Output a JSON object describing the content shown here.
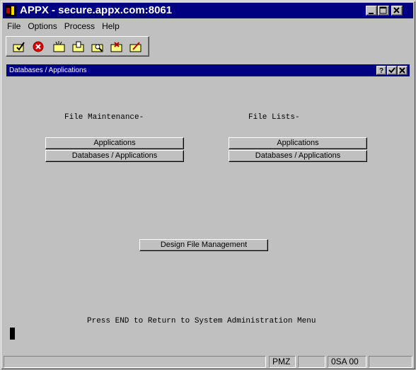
{
  "window": {
    "title": "APPX - secure.appx.com:8061"
  },
  "menu": {
    "items": [
      "File",
      "Options",
      "Process",
      "Help"
    ]
  },
  "toolbar": {
    "icons": [
      "check-folder-icon",
      "cancel-icon",
      "new-folder-icon",
      "open-folder-icon",
      "search-folder-icon",
      "delete-folder-icon",
      "edit-folder-icon"
    ]
  },
  "form": {
    "title": "Databases / Applications",
    "left_heading": "File Maintenance-",
    "right_heading": "File Lists-",
    "left_buttons": [
      "Applications",
      "Databases / Applications"
    ],
    "right_buttons": [
      "Applications",
      "Databases / Applications"
    ],
    "design_button": "Design File Management",
    "footer_text": "Press END to Return to System Administration Menu"
  },
  "status": {
    "cells": [
      "",
      "PMZ",
      "",
      "0SA 00",
      ""
    ]
  },
  "colors": {
    "titlebar": "#000080",
    "background": "#c0c0c0"
  }
}
